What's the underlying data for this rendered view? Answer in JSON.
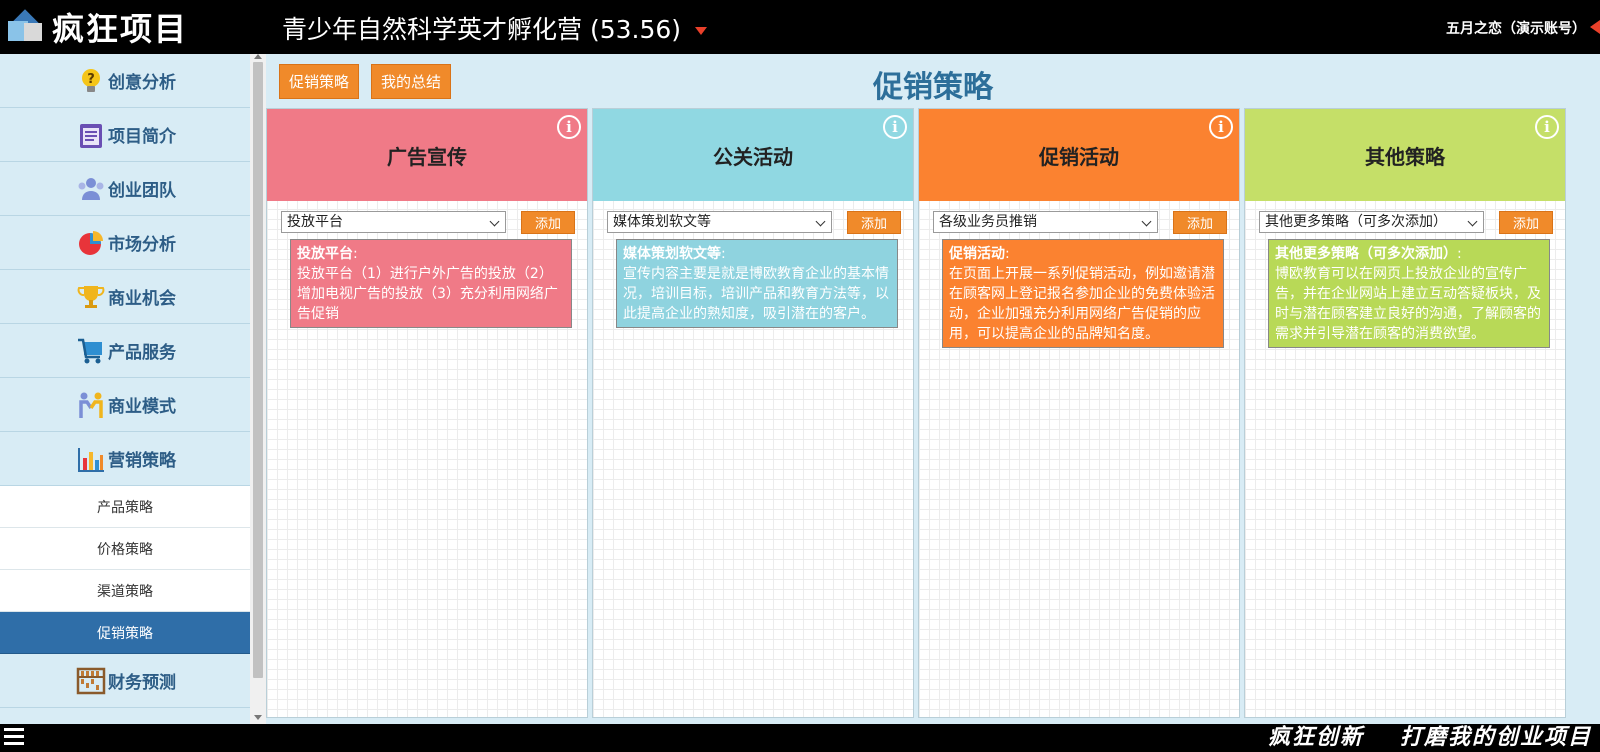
{
  "header": {
    "logo_text": "疯狂项目",
    "title": "青少年自然科学英才孵化营",
    "score": "(53.56)",
    "user": "五月之恋（演示账号）"
  },
  "sidebar": {
    "items": [
      {
        "label": "创意分析",
        "icon": "lightbulb-icon"
      },
      {
        "label": "项目简介",
        "icon": "clipboard-icon"
      },
      {
        "label": "创业团队",
        "icon": "team-icon"
      },
      {
        "label": "市场分析",
        "icon": "pie-chart-icon"
      },
      {
        "label": "商业机会",
        "icon": "trophy-icon"
      },
      {
        "label": "产品服务",
        "icon": "cart-icon"
      },
      {
        "label": "商业模式",
        "icon": "handshake-icon"
      },
      {
        "label": "营销策略",
        "icon": "bar-chart-icon"
      }
    ],
    "sub_items": [
      {
        "label": "产品策略",
        "active": false
      },
      {
        "label": "价格策略",
        "active": false
      },
      {
        "label": "渠道策略",
        "active": false
      },
      {
        "label": "促销策略",
        "active": true
      }
    ],
    "after_items": [
      {
        "label": "财务预测",
        "icon": "abacus-icon"
      }
    ]
  },
  "main": {
    "tabs": [
      "促销策略",
      "我的总结"
    ],
    "page_title": "促销策略",
    "add_label": "添加",
    "columns": [
      {
        "title": "广告宣传",
        "color": "#f07a87",
        "card_color": "#f07a87",
        "select_value": "投放平台",
        "card_title": "投放平台",
        "card_text": "投放平台（1）进行户外广告的投放（2）增加电视广告的投放（3）充分利用网络广告促销"
      },
      {
        "title": "公关活动",
        "color": "#90d8e2",
        "card_color": "#8fd3df",
        "select_value": "媒体策划软文等",
        "card_title": "媒体策划软文等",
        "card_text": "宣传内容主要是就是博欧教育企业的基本情况，培训目标，培训产品和教育方法等，以此提高企业的熟知度，吸引潜在的客户。"
      },
      {
        "title": "促销活动",
        "color": "#fb8230",
        "card_color": "#fb8230",
        "select_value": "各级业务员推销",
        "card_title": "促销活动",
        "card_text": "在页面上开展一系列促销活动，例如邀请潜在顾客网上登记报名参加企业的免费体验活动，企业加强充分利用网络广告促销的应用，可以提高企业的品牌知名度。"
      },
      {
        "title": "其他策略",
        "color": "#c5df68",
        "card_color": "#b8d957",
        "select_value": "其他更多策略（可多次添加）",
        "card_title": "其他更多策略（可多次添加）",
        "card_text": "博欧教育可以在网页上投放企业的宣传广告，并在企业网站上建立互动答疑板块，及时与潜在顾客建立良好的沟通，了解顾客的需求并引导潜在顾客的消费欲望。"
      }
    ]
  },
  "footer": {
    "slogan_left": "疯狂创新",
    "slogan_right": "打磨我的创业项目"
  }
}
